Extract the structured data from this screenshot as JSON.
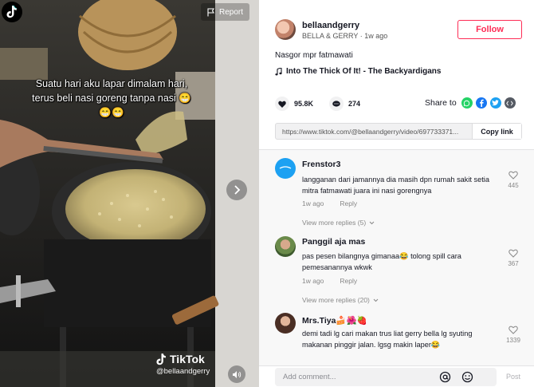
{
  "video": {
    "caption": "Suatu hari aku lapar dimalam hari, terus beli nasi goreng tanpa nasi 😁😁😁",
    "report_label": "Report",
    "watermark_brand": "TikTok",
    "watermark_handle": "@bellaandgerry",
    "icons": [
      "tiktok-logo",
      "flag-icon",
      "chevron-right-icon",
      "volume-icon"
    ]
  },
  "author": {
    "username": "bellaandgerry",
    "display_name": "BELLA & GERRY",
    "time_ago": "1w ago",
    "follow_label": "Follow"
  },
  "post": {
    "description": "Nasgor mpr fatmawati",
    "music_title": "Into The Thick Of It! - The Backyardigans",
    "likes": "95.8K",
    "comments": "274",
    "share_label": "Share to",
    "link_url": "https://www.tiktok.com/@bellaandgerry/video/697733371...",
    "copy_link_label": "Copy link"
  },
  "colors": {
    "accent": "#fe2c55",
    "whatsapp": "#25d366",
    "facebook": "#1877f2",
    "twitter": "#1da1f2",
    "embed": "#555a63"
  },
  "comments": [
    {
      "username": "Frenstor3",
      "text": "langganan dari jamannya dia masih dpn rumah sakit setia mitra fatmawati juara ini nasi gorengnya",
      "time": "1w ago",
      "reply_label": "Reply",
      "likes": "445",
      "view_replies": "View more replies (5)"
    },
    {
      "username": "Panggil aja mas",
      "text": "pas pesen bilangnya gimanaa😂 tolong spill cara pemesanannya wkwk",
      "time": "1w ago",
      "reply_label": "Reply",
      "likes": "367",
      "view_replies": "View more replies (20)"
    },
    {
      "username": "Mrs.Tiya🍰🌺🍓",
      "text": "demi tadi lg cari makan trus liat gerry bella lg syuting makanan pinggir jalan. lgsg makin laper😂",
      "likes": "1339"
    }
  ],
  "composer": {
    "placeholder": "Add comment...",
    "post_label": "Post"
  }
}
